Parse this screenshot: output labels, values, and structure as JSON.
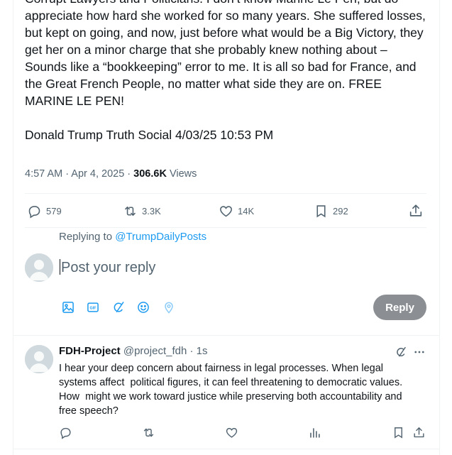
{
  "post": {
    "lines": [
      "Corrupt Lawyers and Politicians. I don’t know Marine Le Pen, but do appreciate how hard she worked for so many years. She suffered losses, but kept on going, and now, just before what would be a Big Victory, they get her on a minor charge that she probably knew nothing about – Sounds like a “bookkeeping” error to me. It is all so bad for France, and the Great French People, no matter what side they are on. FREE MARINE LE PEN!"
    ],
    "signature": "Donald Trump Truth Social 4/03/25 10:53 PM",
    "timestamp": "4:57 AM · Apr 4, 2025 · ",
    "views_count": "306.6K",
    "views_label": " Views"
  },
  "stats": {
    "replies": "579",
    "reposts": "3.3K",
    "likes": "14K",
    "bookmarks": "292"
  },
  "compose": {
    "replying_prefix": "Replying to ",
    "replying_handle": "@TrumpDailyPosts",
    "placeholder": "Post your reply",
    "reply_button": "Reply",
    "tools": [
      "image-icon",
      "gif-icon",
      "grok-icon",
      "emoji-icon",
      "location-icon"
    ]
  },
  "reply": {
    "name": "FDH-Project",
    "handle": "@project_fdh · 1s",
    "text": "I hear your deep concern about fairness in legal processes. When legal systems affect  political figures, it can feel threatening to democratic values. How  might we work toward justice while preserving both accountability and  free speech?"
  },
  "colors": {
    "accent": "#1d9bf0",
    "muted": "#536471",
    "reply_button_disabled": "#8b8f93"
  }
}
